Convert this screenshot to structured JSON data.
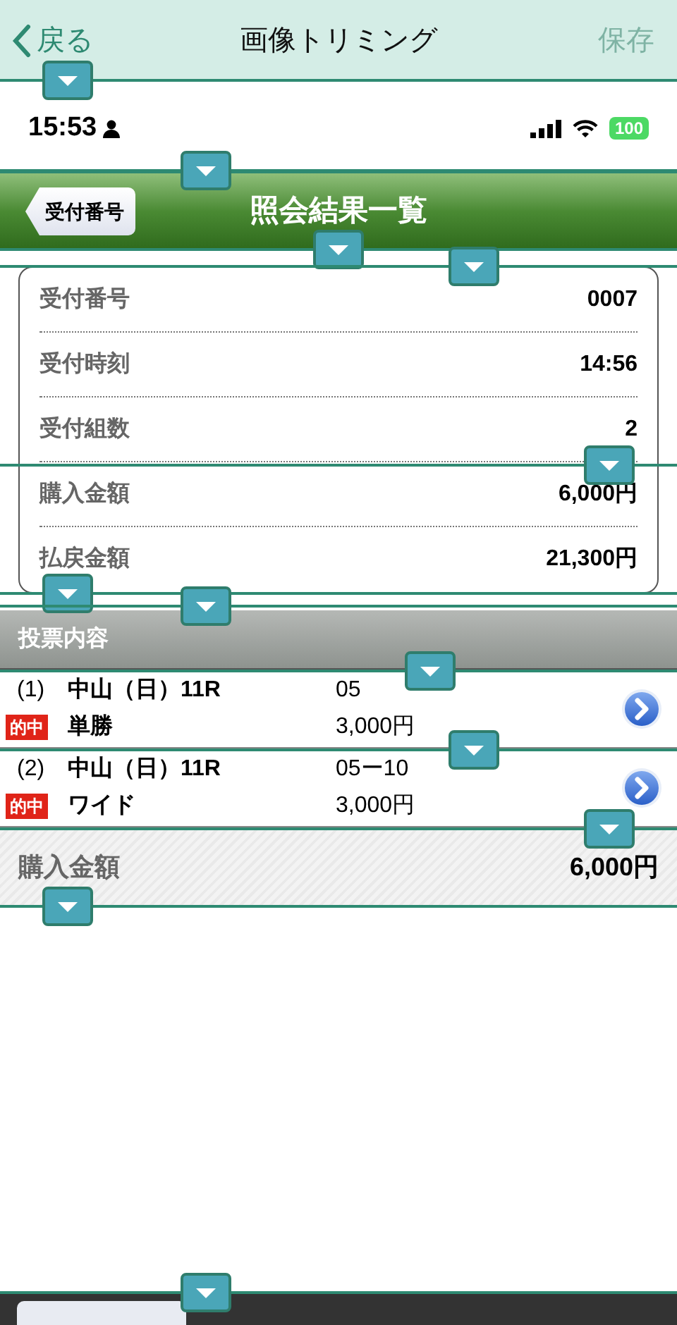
{
  "nav": {
    "back": "戻る",
    "title": "画像トリミング",
    "save": {
      "label": "保存",
      "disabled": true
    }
  },
  "status_bar": {
    "time": "15:53",
    "battery": "100"
  },
  "header": {
    "back": "受付番号",
    "title": "照会結果一覧"
  },
  "info_rows": [
    {
      "label": "受付番号",
      "value": "0007"
    },
    {
      "label": "受付時刻",
      "value": "14:56"
    },
    {
      "label": "受付組数",
      "value": "2"
    },
    {
      "label": "購入金額",
      "value": "6,000円"
    },
    {
      "label": "払戻金額",
      "value": "21,300円"
    }
  ],
  "section_title": "投票内容",
  "bets": [
    {
      "number": "(1)",
      "race": "中山（日）11R",
      "combination": "05",
      "badge": "的中",
      "bet_type": "単勝",
      "amount": "3,000円"
    },
    {
      "number": "(2)",
      "race": "中山（日）11R",
      "combination": "05ー10",
      "badge": "的中",
      "bet_type": "ワイド",
      "amount": "3,000円"
    }
  ],
  "summary": {
    "label": "購入金額",
    "value": "6,000円"
  }
}
